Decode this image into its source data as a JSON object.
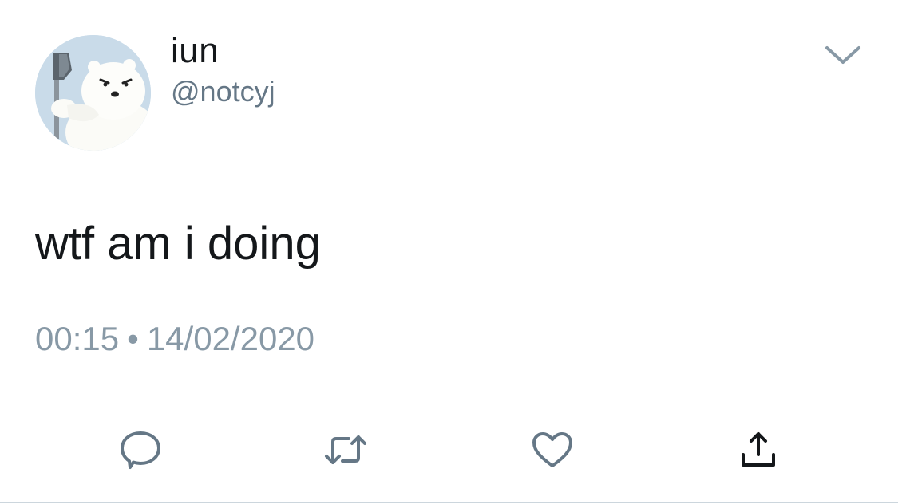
{
  "tweet": {
    "author": {
      "display_name": "iun",
      "handle": "@notcyj",
      "avatar_icon": "polar-bear-avatar"
    },
    "text": "wtf am i doing",
    "time": "00:15",
    "separator": "•",
    "date": "14/02/2020",
    "actions": [
      {
        "name": "reply",
        "icon": "reply-icon"
      },
      {
        "name": "retweet",
        "icon": "retweet-icon"
      },
      {
        "name": "like",
        "icon": "heart-icon"
      },
      {
        "name": "share",
        "icon": "share-icon"
      }
    ],
    "colors": {
      "text": "#14171a",
      "secondary": "#657786",
      "icon": "#657786",
      "divider": "#ccd6dd"
    }
  }
}
